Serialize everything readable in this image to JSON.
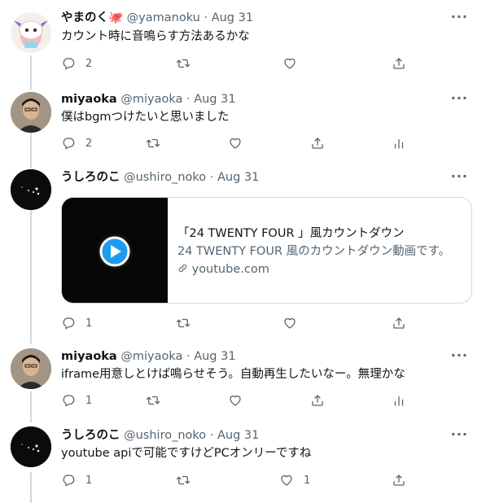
{
  "tweets": [
    {
      "name": "やまのく🐙",
      "handle": "@yamanoku",
      "sep": "·",
      "date": "Aug 31",
      "text": "カウント時に音鳴らす方法あるかな",
      "reply_count": "2",
      "retweet_count": "",
      "like_count": ""
    },
    {
      "name": "miyaoka",
      "handle": "@miyaoka",
      "sep": "·",
      "date": "Aug 31",
      "text": "僕はbgmつけたいと思いました",
      "reply_count": "2",
      "retweet_count": "",
      "like_count": ""
    },
    {
      "name": "うしろのこ",
      "handle": "@ushiro_noko",
      "sep": "·",
      "date": "Aug 31",
      "text": "",
      "reply_count": "1",
      "retweet_count": "",
      "like_count": "",
      "card": {
        "title": "「24 TWENTY FOUR 」風カウントダウン",
        "description": "24 TWENTY FOUR 風のカウントダウン動画です。",
        "domain": "youtube.com"
      }
    },
    {
      "name": "miyaoka",
      "handle": "@miyaoka",
      "sep": "·",
      "date": "Aug 31",
      "text": "iframe用意しとけば鳴らせそう。自動再生したいなー。無理かな",
      "reply_count": "1",
      "retweet_count": "",
      "like_count": ""
    },
    {
      "name": "うしろのこ",
      "handle": "@ushiro_noko",
      "sep": "·",
      "date": "Aug 31",
      "text": "youtube apiで可能ですけどPCオンリーですね",
      "reply_count": "1",
      "retweet_count": "",
      "like_count": "1"
    }
  ],
  "colors": {
    "text": "#0f1419",
    "muted": "#536471",
    "border": "#cfd9de",
    "link_play": "#1d9bf0"
  },
  "icons": [
    "reply-icon",
    "retweet-icon",
    "like-icon",
    "share-icon",
    "analytics-icon",
    "more-icon",
    "play-icon",
    "link-icon"
  ]
}
